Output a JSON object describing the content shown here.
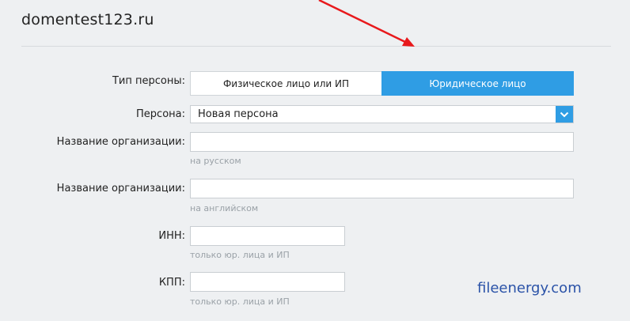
{
  "header": {
    "domain": "domentest123.ru"
  },
  "form": {
    "person_type": {
      "label": "Тип персоны:",
      "options": [
        "Физическое лицо или ИП",
        "Юридическое лицо"
      ],
      "selected": "Юридическое лицо"
    },
    "person": {
      "label": "Персона:",
      "value": "Новая персона"
    },
    "org_name_ru": {
      "label": "Название организации:",
      "value": "",
      "hint": "на русском"
    },
    "org_name_en": {
      "label": "Название организации:",
      "value": "",
      "hint": "на английском"
    },
    "inn": {
      "label": "ИНН:",
      "value": "",
      "hint": "только юр. лица и ИП"
    },
    "kpp": {
      "label": "КПП:",
      "value": "",
      "hint": "только юр. лица и ИП"
    }
  },
  "watermark": "fileenergy.com",
  "colors": {
    "accent": "#2f9de4",
    "arrow": "#e8191c",
    "background": "#eef0f2"
  }
}
